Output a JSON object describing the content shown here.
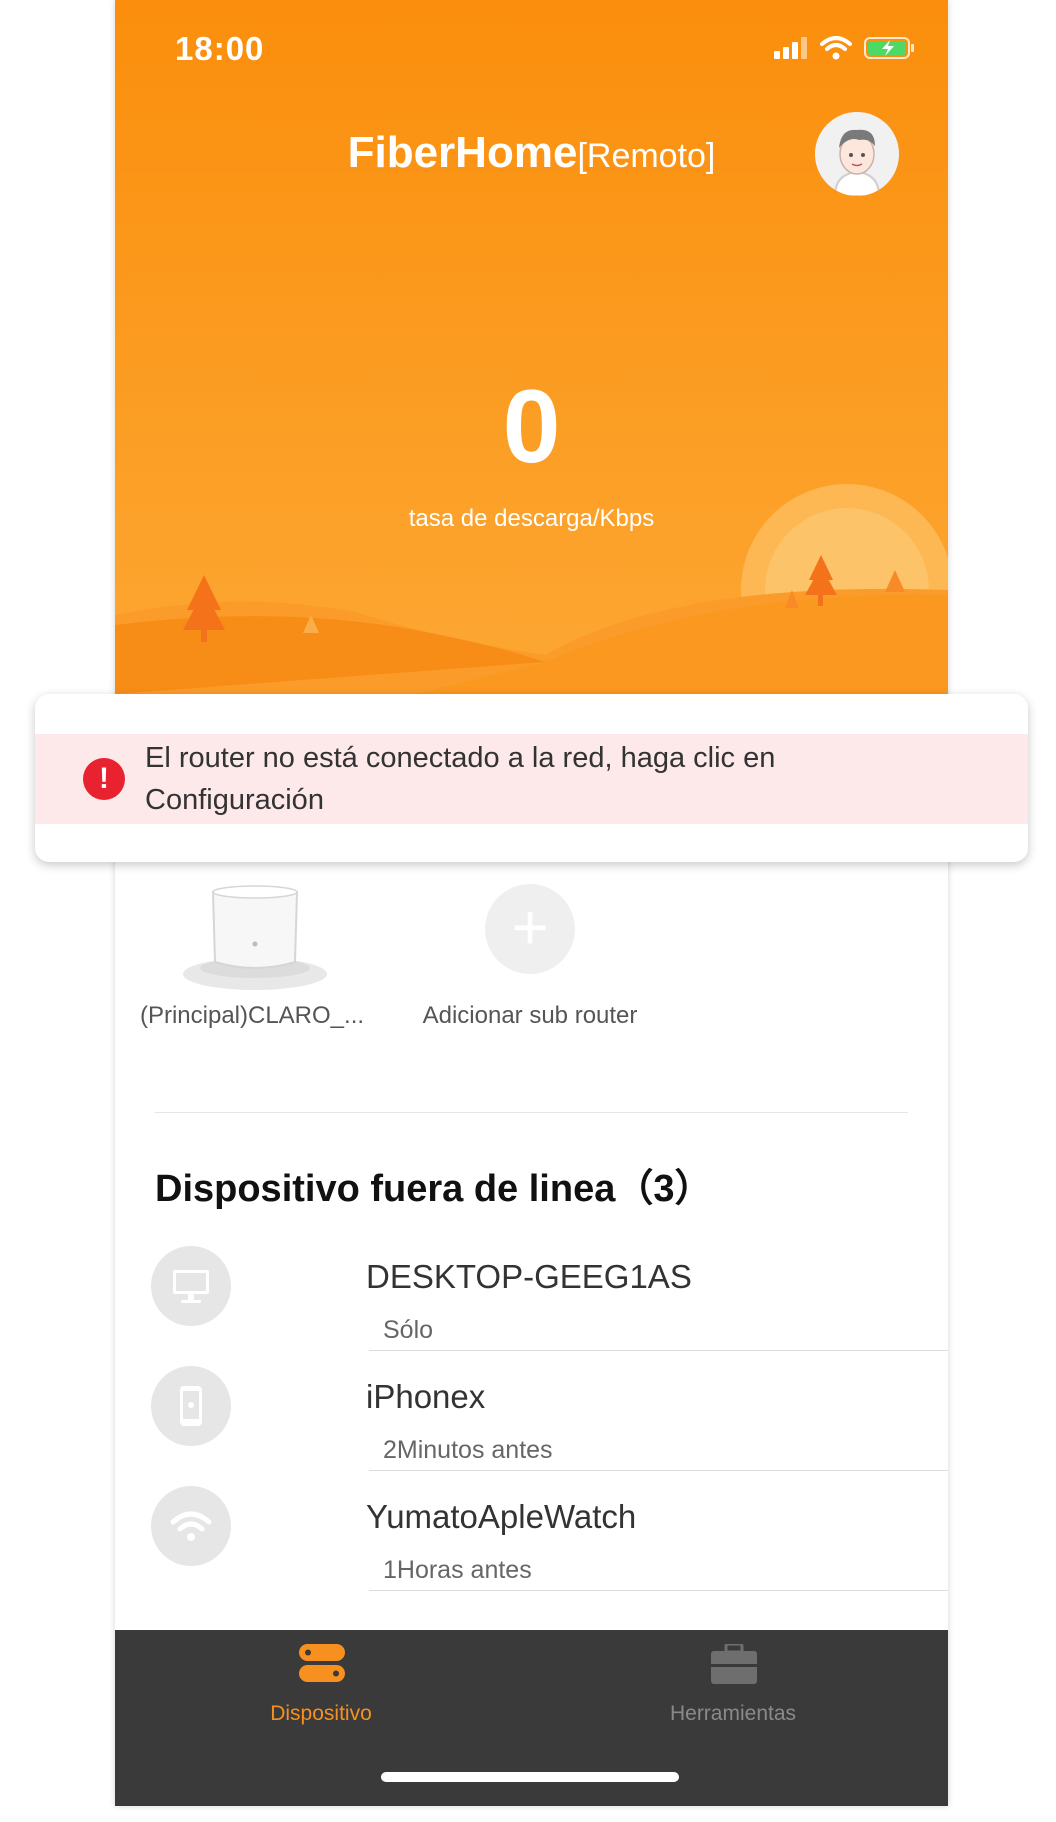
{
  "status_bar": {
    "time": "18:00"
  },
  "header": {
    "brand": "FiberHome",
    "mode": "[Remoto]"
  },
  "download": {
    "value": "0",
    "label": "tasa de descarga/Kbps"
  },
  "alert": {
    "message": "El router no está conectado a la red, haga clic en Configuración"
  },
  "routers": {
    "main_label": "(Principal)CLARO_...",
    "add_label": "Adicionar sub router"
  },
  "offline_section": {
    "title": "Dispositivo fuera de linea（3）",
    "devices": [
      {
        "name": "DESKTOP-GEEG1AS",
        "status": "Sólo",
        "icon": "desktop-icon"
      },
      {
        "name": "iPhonex",
        "status": "2Minutos antes",
        "icon": "phone-icon"
      },
      {
        "name": "YumatoApleWatch",
        "status": "1Horas antes",
        "icon": "wifi-icon"
      }
    ]
  },
  "tabs": [
    {
      "label": "Dispositivo",
      "active": true,
      "icon": "device-tab-icon"
    },
    {
      "label": "Herramientas",
      "active": false,
      "icon": "toolbox-icon"
    }
  ],
  "colors": {
    "accent": "#fb8e0c",
    "alert_bg": "#fde9ea",
    "alert_icon": "#e8222f",
    "tabbar": "#3a3a3a"
  }
}
